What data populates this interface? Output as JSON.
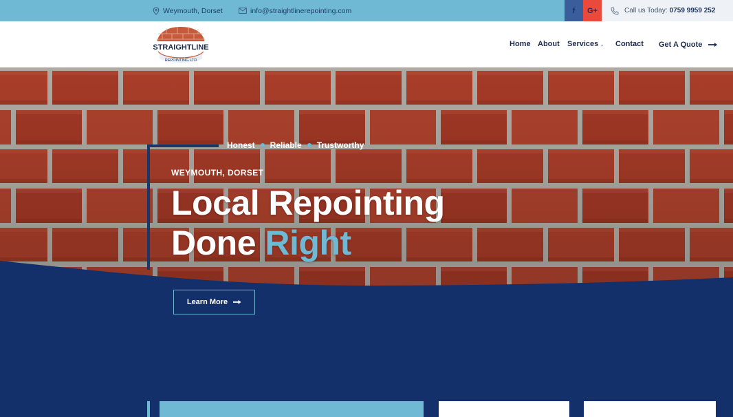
{
  "topbar": {
    "location": "Weymouth, Dorset",
    "email": "info@straightlinerepointing.com",
    "social": {
      "facebook": "f",
      "googleplus": "G+"
    },
    "call_label": "Call us Today:",
    "phone": "0759 9959 252"
  },
  "logo": {
    "name": "STRAIGHTLINE",
    "sub": "REPOINTING LTD"
  },
  "nav": {
    "home": "Home",
    "about": "About",
    "services": "Services",
    "contact": "Contact",
    "quote": "Get A Quote"
  },
  "hero": {
    "tags": [
      "Honest",
      "Reliable",
      "Trustworthy"
    ],
    "location": "WEYMOUTH, DORSET",
    "headline_line1": "Local Repointing",
    "headline_line2_a": "Done",
    "headline_line2_b": "Right",
    "button": "Learn More"
  },
  "colors": {
    "accent": "#6fb9d4",
    "navy": "#13306a",
    "brick": "#b2412c"
  }
}
